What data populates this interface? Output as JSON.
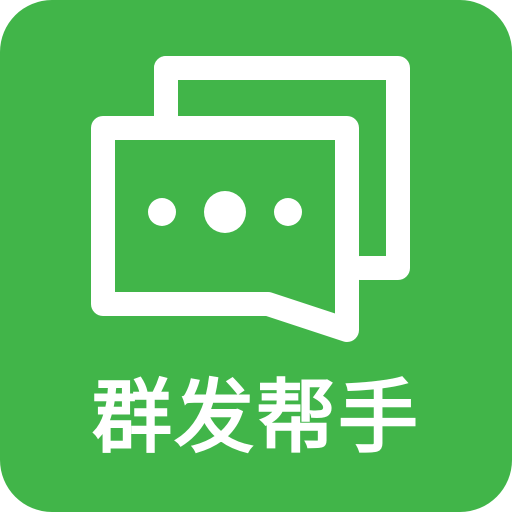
{
  "icon": {
    "app_name": "群发帮手",
    "symbol": "chat-bubbles-icon",
    "colors": {
      "background": "#41b549",
      "foreground": "#ffffff"
    }
  }
}
